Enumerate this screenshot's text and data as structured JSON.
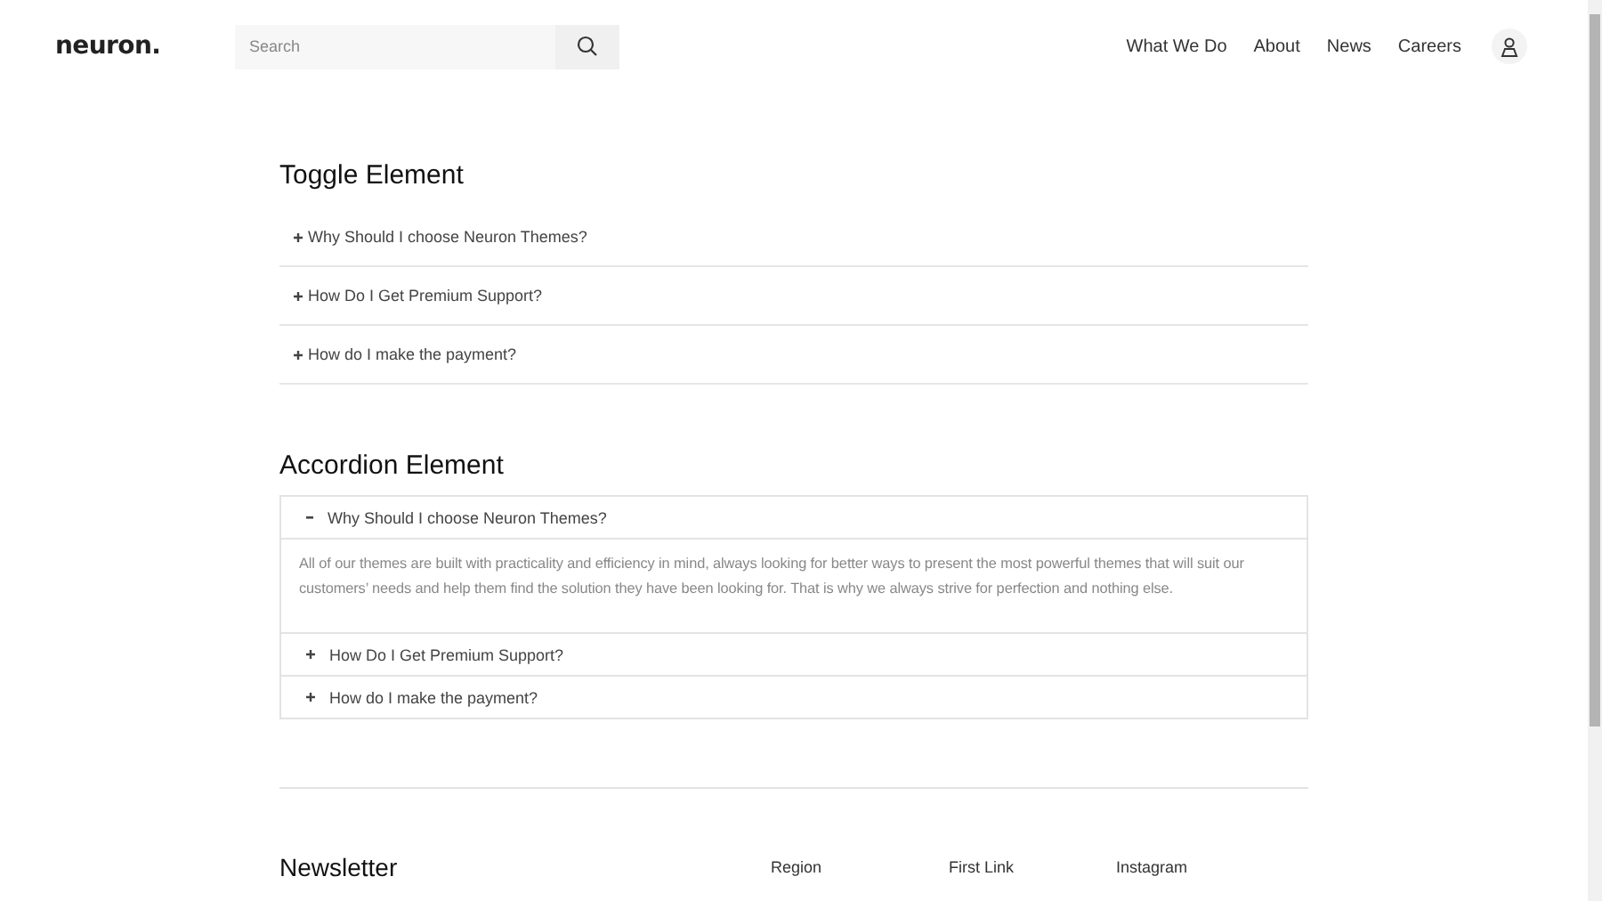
{
  "header": {
    "logo": "neuron.",
    "search": {
      "placeholder": "Search"
    },
    "nav": [
      "What We Do",
      "About",
      "News",
      "Careers"
    ]
  },
  "toggle_section": {
    "title": "Toggle Element",
    "items": [
      {
        "label": "Why Should I choose Neuron Themes?",
        "expanded": false
      },
      {
        "label": "How Do I Get Premium Support?",
        "expanded": false
      },
      {
        "label": "How do I make the payment?",
        "expanded": false
      }
    ]
  },
  "accordion_section": {
    "title": "Accordion Element",
    "items": [
      {
        "label": "Why Should I choose Neuron Themes?",
        "expanded": true,
        "body": "All of our themes are built with practicality and efficiency in mind, always looking for better ways to present the most powerful themes that will suit our customers’ needs and help them find the solution they have been looking for. That is why we always strive for perfection and nothing else."
      },
      {
        "label": "How Do I Get Premium Support?",
        "expanded": false
      },
      {
        "label": "How do I make the payment?",
        "expanded": false
      }
    ]
  },
  "footer": {
    "title": "Newsletter",
    "links": [
      "Region",
      "First Link",
      "Instagram"
    ]
  }
}
